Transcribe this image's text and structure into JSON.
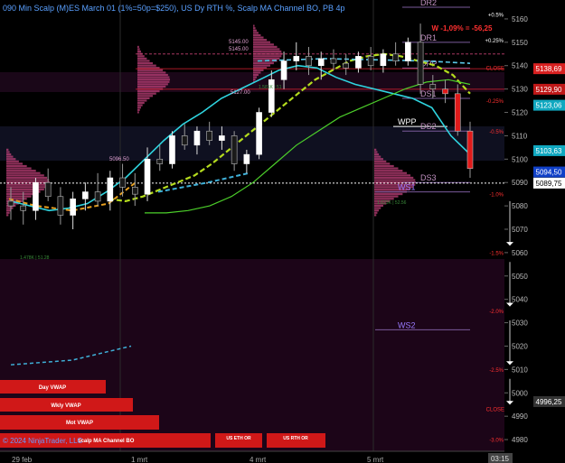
{
  "title": "090 Min Scalp (M)ES March 01 (1%=50p=$250), US Dy RTH %, Scalp MA Channel BO, PB 4p",
  "copyright": "© 2024 NinjaTrader, LLC",
  "time_label": "03:15",
  "colors": {
    "background": "#000000",
    "lower_zone": "#1c0518",
    "title": "#5aa0ff",
    "up_candle": "#ffffff",
    "down_candle": "#1a1a1a",
    "cyan_ma": "#2fd5e0",
    "green_ma": "#4ccf2a",
    "yellow_ma": "#b4dc1e",
    "orange_ma": "#e8a020",
    "profile": "#c0407a",
    "red_level": "#e02030",
    "pivot_line": "#7a5a9a"
  },
  "header_stats": {
    "weekly_change": "W -1,09% = -56,25",
    "pct_labels": [
      "+0.5%",
      "+0.25%",
      "-0.25%",
      "-0.5%",
      "-1.0%",
      "-1.5%",
      "-2.0%",
      "-2.5%",
      "-3.0%"
    ]
  },
  "pivot_labels": [
    "DR2",
    "DR1",
    "DPP",
    "DS1",
    "WPP",
    "DS2",
    "DS3",
    "WS1",
    "WS2"
  ],
  "close_labels": [
    "CLOSE",
    "CLOSE"
  ],
  "price_badges": [
    {
      "label": "5138,69",
      "price": 5138.69,
      "color": "#d82020"
    },
    {
      "label": "5129,90",
      "price": 5129.9,
      "color": "#c01818"
    },
    {
      "label": "5123,06",
      "price": 5123.06,
      "color": "#10a8c0"
    },
    {
      "label": "5103,63",
      "price": 5103.63,
      "color": "#10a8c0"
    },
    {
      "label": "5094,50",
      "price": 5094.5,
      "color": "#1040c8"
    },
    {
      "label": "5089,75",
      "price": 5089.75,
      "color": "#ffffff"
    },
    {
      "label": "4996,25",
      "price": 4996.25,
      "color": "#333333"
    }
  ],
  "profile_labels": [
    "5145.00",
    "5145.00",
    "5127.00",
    "5096.50",
    "1.581K | 51",
    "1.623K | 52.56",
    "1.478K | 51.28"
  ],
  "buttons": [
    {
      "label": "Day VWAP"
    },
    {
      "label": "Wkly VWAP"
    },
    {
      "label": "Mot VWAP"
    },
    {
      "label": "Scalp MA Channel BO"
    },
    {
      "label": ""
    },
    {
      "label": "US ETH OR"
    },
    {
      "label": "US RTH OR"
    }
  ],
  "chart_data": {
    "type": "candlestick",
    "xlabel": "",
    "ylabel": "",
    "x_ticks": [
      "29 feb",
      "1 mrt",
      "4 mrt",
      "5 mrt"
    ],
    "y_ticks": [
      4980,
      4990,
      5000,
      5010,
      5020,
      5030,
      5040,
      5050,
      5060,
      5070,
      5080,
      5090,
      5100,
      5110,
      5120,
      5130,
      5140,
      5150,
      5160
    ],
    "ylim": [
      4975,
      5165
    ],
    "grid": false,
    "candles": [
      [
        5082,
        5088,
        5074,
        5080
      ],
      [
        5080,
        5086,
        5072,
        5078
      ],
      [
        5078,
        5092,
        5074,
        5090
      ],
      [
        5090,
        5096,
        5082,
        5084
      ],
      [
        5084,
        5088,
        5072,
        5076
      ],
      [
        5076,
        5086,
        5070,
        5083
      ],
      [
        5083,
        5090,
        5078,
        5086
      ],
      [
        5086,
        5094,
        5080,
        5082
      ],
      [
        5082,
        5095,
        5078,
        5092
      ],
      [
        5092,
        5098,
        5084,
        5088
      ],
      [
        5088,
        5094,
        5080,
        5085
      ],
      [
        5085,
        5105,
        5082,
        5100
      ],
      [
        5100,
        5106,
        5095,
        5098
      ],
      [
        5098,
        5112,
        5096,
        5110
      ],
      [
        5110,
        5115,
        5104,
        5106
      ],
      [
        5106,
        5114,
        5102,
        5112
      ],
      [
        5112,
        5116,
        5106,
        5108
      ],
      [
        5108,
        5114,
        5104,
        5110
      ],
      [
        5110,
        5112,
        5095,
        5098
      ],
      [
        5098,
        5104,
        5094,
        5102
      ],
      [
        5102,
        5122,
        5100,
        5120
      ],
      [
        5120,
        5138,
        5118,
        5134
      ],
      [
        5134,
        5146,
        5130,
        5142
      ],
      [
        5142,
        5150,
        5138,
        5144
      ],
      [
        5144,
        5148,
        5136,
        5140
      ],
      [
        5140,
        5146,
        5134,
        5143
      ],
      [
        5143,
        5147,
        5138,
        5141
      ],
      [
        5141,
        5145,
        5136,
        5139
      ],
      [
        5139,
        5146,
        5137,
        5144
      ],
      [
        5144,
        5148,
        5138,
        5140
      ],
      [
        5140,
        5147,
        5137,
        5145
      ],
      [
        5145,
        5150,
        5140,
        5142
      ],
      [
        5142,
        5152,
        5140,
        5150
      ],
      [
        5150,
        5158,
        5128,
        5132
      ],
      [
        5132,
        5136,
        5126,
        5130
      ],
      [
        5130,
        5134,
        5124,
        5128
      ],
      [
        5128,
        5132,
        5110,
        5112
      ],
      [
        5112,
        5116,
        5092,
        5096
      ]
    ],
    "series": [
      {
        "name": "",
        "values": [
          5082,
          5080,
          5078,
          5079,
          5081,
          5086,
          5092,
          5100,
          5108,
          5115,
          5120,
          5126,
          5130,
          5134,
          5138,
          5140,
          5139,
          5135,
          5132,
          5130,
          5128,
          5126,
          5122,
          5110,
          5102
        ]
      },
      {
        "name": "",
        "values": [
          5083,
          5082,
          5084,
          5087,
          5090,
          5093,
          5098,
          5104,
          5110,
          5116,
          5122,
          5128,
          5134,
          5138,
          5142,
          5144,
          5145,
          5144,
          5142,
          5140,
          5136,
          5128
        ]
      },
      {
        "name": "",
        "values": [
          5077,
          5077,
          5078,
          5080,
          5084,
          5090,
          5098,
          5106,
          5112,
          5118,
          5122,
          5126,
          5130,
          5133,
          5134,
          5132
        ]
      }
    ],
    "levels": {
      "DR2": 5165,
      "DR1": 5150,
      "DPP": 5139,
      "DS1": 5126,
      "WPP": 5114,
      "DS2": 5112,
      "DS3": 5090,
      "WS1": 5086,
      "WS2": 5027
    },
    "horizontal_lines": [
      5145,
      5089.75,
      5138.69,
      5129.9
    ]
  }
}
